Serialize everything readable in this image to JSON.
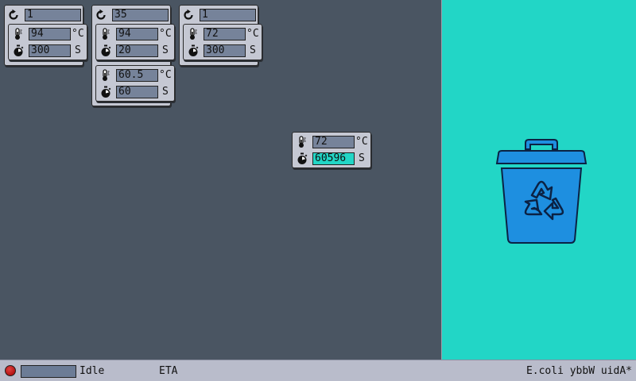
{
  "programs": [
    {
      "repeat": "1",
      "steps": [
        {
          "temperature": "94",
          "duration": "300"
        }
      ]
    },
    {
      "repeat": "35",
      "steps": [
        {
          "temperature": "94",
          "duration": "20"
        },
        {
          "temperature": "60.5",
          "duration": "60"
        }
      ]
    },
    {
      "repeat": "1",
      "steps": [
        {
          "temperature": "72",
          "duration": "300"
        }
      ]
    }
  ],
  "floating_step": {
    "temperature": "72",
    "duration": "60596"
  },
  "units": {
    "temperature": "°C",
    "time": "S"
  },
  "status": {
    "state": "Idle",
    "eta_label": "ETA",
    "program_name": "E.coli ybbW uidA*"
  },
  "colors": {
    "workspace": "#4a5562",
    "trash_zone": "#22d6c6",
    "card": "#c5c8d3",
    "field": "#76839a",
    "active_field": "#22d6c6",
    "status_led": "#c81e1e",
    "trash_can": "#1e8fe0"
  },
  "icons": {
    "repeat": "repeat-icon",
    "temperature": "thermometer-icon",
    "time": "stopwatch-icon",
    "trash": "recycle-bin-icon"
  }
}
